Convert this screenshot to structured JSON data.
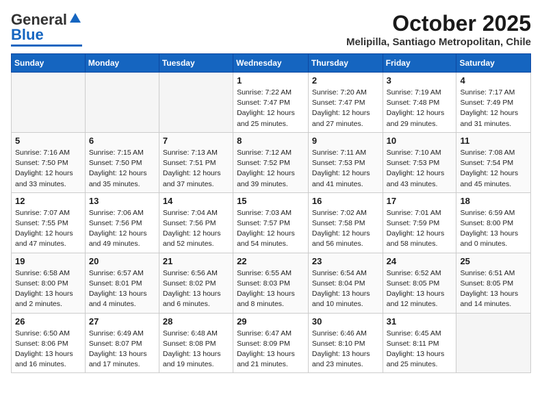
{
  "header": {
    "logo_general": "General",
    "logo_blue": "Blue",
    "month_title": "October 2025",
    "location": "Melipilla, Santiago Metropolitan, Chile"
  },
  "days_of_week": [
    "Sunday",
    "Monday",
    "Tuesday",
    "Wednesday",
    "Thursday",
    "Friday",
    "Saturday"
  ],
  "weeks": [
    [
      {
        "day": "",
        "empty": true
      },
      {
        "day": "",
        "empty": true
      },
      {
        "day": "",
        "empty": true
      },
      {
        "day": "1",
        "sunrise": "7:22 AM",
        "sunset": "7:47 PM",
        "daylight": "12 hours and 25 minutes."
      },
      {
        "day": "2",
        "sunrise": "7:20 AM",
        "sunset": "7:47 PM",
        "daylight": "12 hours and 27 minutes."
      },
      {
        "day": "3",
        "sunrise": "7:19 AM",
        "sunset": "7:48 PM",
        "daylight": "12 hours and 29 minutes."
      },
      {
        "day": "4",
        "sunrise": "7:17 AM",
        "sunset": "7:49 PM",
        "daylight": "12 hours and 31 minutes."
      }
    ],
    [
      {
        "day": "5",
        "sunrise": "7:16 AM",
        "sunset": "7:50 PM",
        "daylight": "12 hours and 33 minutes."
      },
      {
        "day": "6",
        "sunrise": "7:15 AM",
        "sunset": "7:50 PM",
        "daylight": "12 hours and 35 minutes."
      },
      {
        "day": "7",
        "sunrise": "7:13 AM",
        "sunset": "7:51 PM",
        "daylight": "12 hours and 37 minutes."
      },
      {
        "day": "8",
        "sunrise": "7:12 AM",
        "sunset": "7:52 PM",
        "daylight": "12 hours and 39 minutes."
      },
      {
        "day": "9",
        "sunrise": "7:11 AM",
        "sunset": "7:53 PM",
        "daylight": "12 hours and 41 minutes."
      },
      {
        "day": "10",
        "sunrise": "7:10 AM",
        "sunset": "7:53 PM",
        "daylight": "12 hours and 43 minutes."
      },
      {
        "day": "11",
        "sunrise": "7:08 AM",
        "sunset": "7:54 PM",
        "daylight": "12 hours and 45 minutes."
      }
    ],
    [
      {
        "day": "12",
        "sunrise": "7:07 AM",
        "sunset": "7:55 PM",
        "daylight": "12 hours and 47 minutes."
      },
      {
        "day": "13",
        "sunrise": "7:06 AM",
        "sunset": "7:56 PM",
        "daylight": "12 hours and 49 minutes."
      },
      {
        "day": "14",
        "sunrise": "7:04 AM",
        "sunset": "7:56 PM",
        "daylight": "12 hours and 52 minutes."
      },
      {
        "day": "15",
        "sunrise": "7:03 AM",
        "sunset": "7:57 PM",
        "daylight": "12 hours and 54 minutes."
      },
      {
        "day": "16",
        "sunrise": "7:02 AM",
        "sunset": "7:58 PM",
        "daylight": "12 hours and 56 minutes."
      },
      {
        "day": "17",
        "sunrise": "7:01 AM",
        "sunset": "7:59 PM",
        "daylight": "12 hours and 58 minutes."
      },
      {
        "day": "18",
        "sunrise": "6:59 AM",
        "sunset": "8:00 PM",
        "daylight": "13 hours and 0 minutes."
      }
    ],
    [
      {
        "day": "19",
        "sunrise": "6:58 AM",
        "sunset": "8:00 PM",
        "daylight": "13 hours and 2 minutes."
      },
      {
        "day": "20",
        "sunrise": "6:57 AM",
        "sunset": "8:01 PM",
        "daylight": "13 hours and 4 minutes."
      },
      {
        "day": "21",
        "sunrise": "6:56 AM",
        "sunset": "8:02 PM",
        "daylight": "13 hours and 6 minutes."
      },
      {
        "day": "22",
        "sunrise": "6:55 AM",
        "sunset": "8:03 PM",
        "daylight": "13 hours and 8 minutes."
      },
      {
        "day": "23",
        "sunrise": "6:54 AM",
        "sunset": "8:04 PM",
        "daylight": "13 hours and 10 minutes."
      },
      {
        "day": "24",
        "sunrise": "6:52 AM",
        "sunset": "8:05 PM",
        "daylight": "13 hours and 12 minutes."
      },
      {
        "day": "25",
        "sunrise": "6:51 AM",
        "sunset": "8:05 PM",
        "daylight": "13 hours and 14 minutes."
      }
    ],
    [
      {
        "day": "26",
        "sunrise": "6:50 AM",
        "sunset": "8:06 PM",
        "daylight": "13 hours and 16 minutes."
      },
      {
        "day": "27",
        "sunrise": "6:49 AM",
        "sunset": "8:07 PM",
        "daylight": "13 hours and 17 minutes."
      },
      {
        "day": "28",
        "sunrise": "6:48 AM",
        "sunset": "8:08 PM",
        "daylight": "13 hours and 19 minutes."
      },
      {
        "day": "29",
        "sunrise": "6:47 AM",
        "sunset": "8:09 PM",
        "daylight": "13 hours and 21 minutes."
      },
      {
        "day": "30",
        "sunrise": "6:46 AM",
        "sunset": "8:10 PM",
        "daylight": "13 hours and 23 minutes."
      },
      {
        "day": "31",
        "sunrise": "6:45 AM",
        "sunset": "8:11 PM",
        "daylight": "13 hours and 25 minutes."
      },
      {
        "day": "",
        "empty": true
      }
    ]
  ]
}
